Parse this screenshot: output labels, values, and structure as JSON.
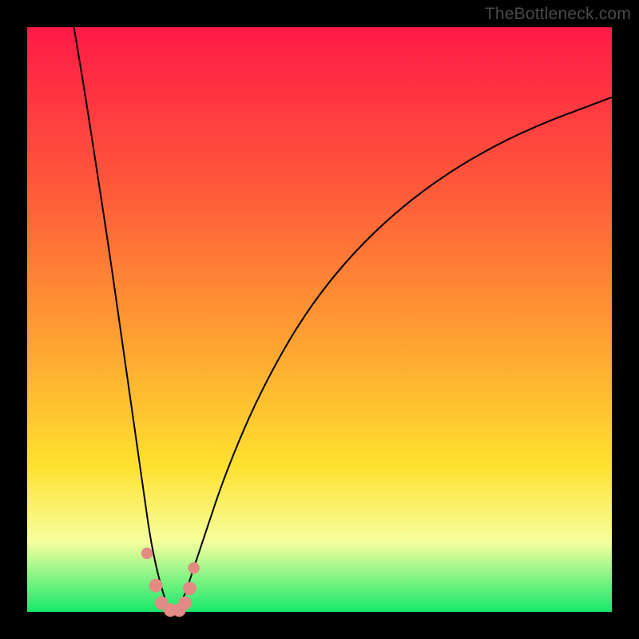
{
  "watermark": "TheBottleneck.com",
  "colors": {
    "top": "#ff1a47",
    "upper": "#ff5a3a",
    "mid": "#ffa531",
    "yellow": "#ffe12f",
    "pale": "#f6ff9e",
    "green": "#17e86b",
    "curve": "#000000",
    "dot": "#e38a84"
  },
  "chart_data": {
    "type": "line",
    "title": "",
    "xlabel": "",
    "ylabel": "",
    "xlim": [
      0,
      100
    ],
    "ylim": [
      0,
      100
    ],
    "series": [
      {
        "name": "bottleneck-curve",
        "x": [
          8,
          10,
          12,
          14,
          16,
          18,
          20,
          21,
          22,
          23,
          24,
          25,
          26,
          27,
          28,
          30,
          34,
          40,
          48,
          58,
          70,
          84,
          100
        ],
        "y": [
          100,
          88,
          75,
          62,
          48,
          34,
          20,
          13,
          8,
          4,
          1,
          0,
          1,
          3,
          6,
          12,
          24,
          38,
          52,
          64,
          74,
          82,
          88
        ]
      }
    ],
    "markers": [
      {
        "x": 20.5,
        "y": 10,
        "r": 1.2
      },
      {
        "x": 22.0,
        "y": 4.5,
        "r": 1.4
      },
      {
        "x": 23.0,
        "y": 1.5,
        "r": 1.4
      },
      {
        "x": 24.5,
        "y": 0.3,
        "r": 1.4
      },
      {
        "x": 26.0,
        "y": 0.3,
        "r": 1.4
      },
      {
        "x": 27.0,
        "y": 1.5,
        "r": 1.4
      },
      {
        "x": 27.8,
        "y": 4.0,
        "r": 1.4
      },
      {
        "x": 28.5,
        "y": 7.5,
        "r": 1.2
      }
    ]
  }
}
